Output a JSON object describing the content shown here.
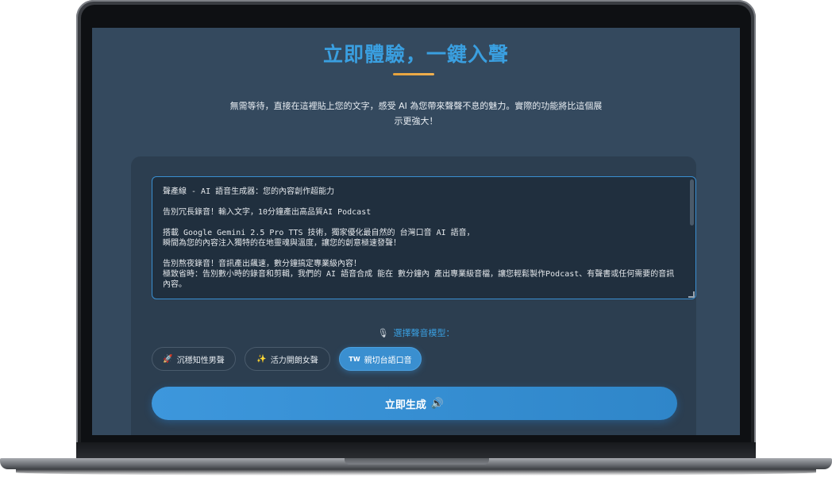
{
  "page": {
    "title": "立即體驗，一鍵入聲",
    "description": "無需等待，直接在這裡貼上您的文字，感受 AI 為您帶來聲聲不息的魅力。實際的功能將比這個展示更強大！"
  },
  "editor": {
    "lines": [
      "聲產線 - AI 語音生成器：您的內容創作超能力",
      "告別冗長錄音！輸入文字，10分鐘產出高品質AI Podcast",
      "搭載 Google Gemini 2.5 Pro TTS 技術，獨家優化最自然的 台灣口音 AI 語音，",
      "瞬間為您的內容注入獨特的在地靈魂與溫度，讓您的創意極速發聲！",
      "告別熬夜錄音！音訊產出飆速，數分鐘搞定專業級內容！",
      "極致省時：告別數小時的錄音和剪輯，我們的 AI 語音合成 能在 數分鐘內 產出專業級音檔，讓您輕鬆製作Podcast、有聲書或任何需要的音訊內容。"
    ]
  },
  "voice": {
    "label": "選擇聲音模型：",
    "mic_icon": "🎙",
    "options": [
      {
        "icon": "🚀",
        "label": "沉穩知性男聲",
        "active": false
      },
      {
        "icon": "✨",
        "label": "活力開朗女聲",
        "active": false
      },
      {
        "icon": "TW",
        "label": "親切台語口音",
        "active": true
      }
    ]
  },
  "generate": {
    "label": "立即生成",
    "icon": "🔊"
  },
  "colors": {
    "accent": "#3a9fe0",
    "screen_bg": "#34495e",
    "card_bg": "#2c3e50",
    "underline": "#e6a23c"
  }
}
